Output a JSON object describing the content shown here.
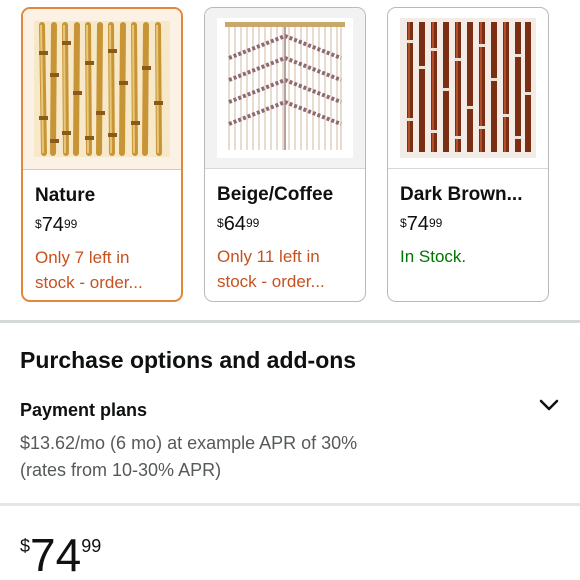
{
  "variants": [
    {
      "name": "Nature",
      "price_symbol": "$",
      "price_whole": "74",
      "price_fraction": "99",
      "stock_line1": "Only 7 left in",
      "stock_line2": "stock - order...",
      "stock_color": "#c7511f",
      "selected": true
    },
    {
      "name": "Beige/Coffee",
      "price_symbol": "$",
      "price_whole": "64",
      "price_fraction": "99",
      "stock_line1": "Only 11 left in",
      "stock_line2": "stock - order...",
      "stock_color": "#c7511f",
      "selected": false
    },
    {
      "name": "Dark Brown...",
      "price_symbol": "$",
      "price_whole": "74",
      "price_fraction": "99",
      "stock_line1": "In Stock.",
      "stock_line2": "",
      "stock_color": "#007600",
      "selected": false
    }
  ],
  "purchase": {
    "section_title": "Purchase options and add-ons",
    "payment_title": "Payment plans",
    "payment_line1": "$13.62/mo (6 mo) at example APR of 30%",
    "payment_line2": "(rates from 10-30% APR)",
    "chevron_icon": "chevron-down-icon"
  },
  "price": {
    "symbol": "$",
    "whole": "74",
    "fraction": "99"
  },
  "colors": {
    "selected_border": "#e3873a",
    "low_stock": "#c7511f",
    "in_stock": "#007600"
  }
}
